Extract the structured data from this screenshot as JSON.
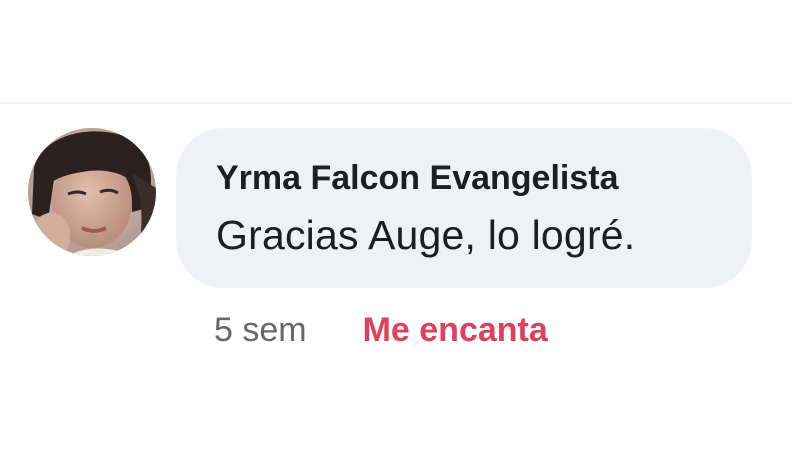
{
  "comment": {
    "author": "Yrma Falcon Evangelista",
    "message": "Gracias Auge, lo logré.",
    "timestamp": "5 sem",
    "reaction": "Me encanta"
  },
  "colors": {
    "bubble_background": "#f0f1f4",
    "author_text": "#1c1e21",
    "timestamp_text": "#65676b",
    "reaction_text": "#e0405e"
  },
  "icons": {
    "avatar": "user-avatar-photo"
  }
}
